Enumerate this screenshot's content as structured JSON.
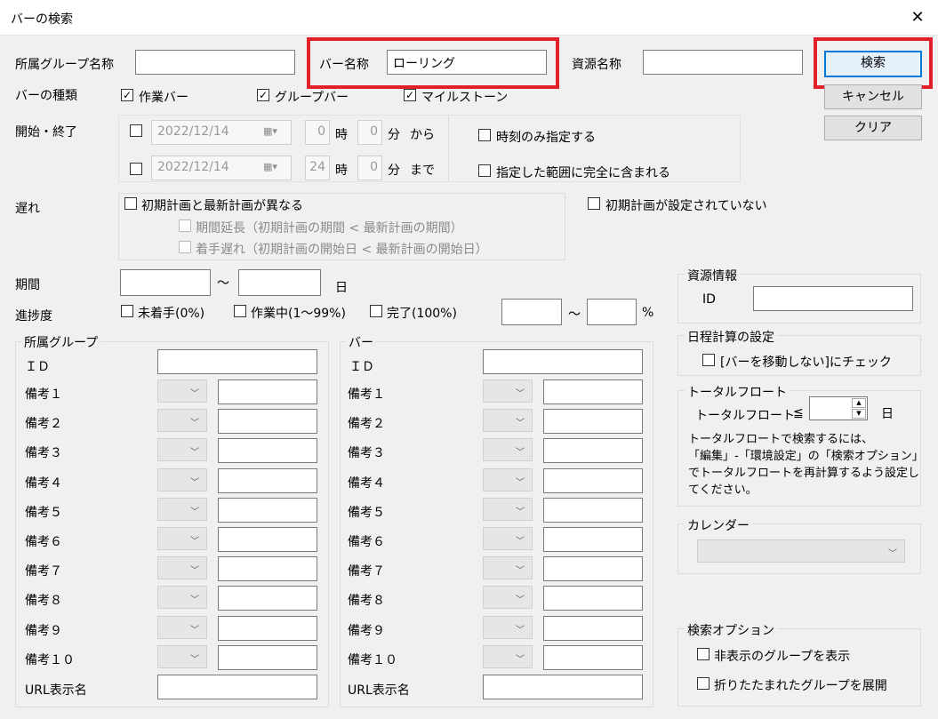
{
  "window": {
    "title": "バーの検索",
    "close": "✕"
  },
  "top": {
    "group_name_label": "所属グループ名称",
    "group_name_value": "",
    "bar_name_label": "バー名称",
    "bar_name_value": "ローリング",
    "resource_name_label": "資源名称",
    "resource_name_value": ""
  },
  "buttons": {
    "search": "検索",
    "cancel": "キャンセル",
    "clear": "クリア"
  },
  "bar_type": {
    "label": "バーの種類",
    "options": [
      {
        "label": "作業バー",
        "checked": true
      },
      {
        "label": "グループバー",
        "checked": true
      },
      {
        "label": "マイルストーン",
        "checked": true
      }
    ]
  },
  "start_end": {
    "label": "開始・終了",
    "rows": [
      {
        "date": "2022/12/14",
        "hour": "0",
        "hour_unit": "時",
        "minute": "0",
        "minute_unit": "分",
        "suffix": "から"
      },
      {
        "date": "2022/12/14",
        "hour": "24",
        "hour_unit": "時",
        "minute": "0",
        "minute_unit": "分",
        "suffix": "まで"
      }
    ],
    "time_only": "時刻のみ指定する",
    "fully_contained": "指定した範囲に完全に含まれる"
  },
  "delay": {
    "label": "遅れ",
    "differs": "初期計画と最新計画が異なる",
    "period_ext": "期間延長（初期計画の期間 < 最新計画の期間）",
    "start_delay": "着手遅れ（初期計画の開始日 < 最新計画の開始日）",
    "not_set": "初期計画が設定されていない"
  },
  "period": {
    "label": "期間",
    "tilde": "〜",
    "unit": "日"
  },
  "progress": {
    "label": "進捗度",
    "options": [
      "未着手(0%)",
      "作業中(1〜99%)",
      "完了(100%)"
    ],
    "tilde": "〜",
    "unit": "%"
  },
  "group_section": {
    "title": "所属グループ",
    "id_label": "ＩＤ",
    "notes": [
      "備考１",
      "備考２",
      "備考３",
      "備考４",
      "備考５",
      "備考６",
      "備考７",
      "備考８",
      "備考９",
      "備考１０"
    ],
    "url_label": "URL表示名"
  },
  "bar_section": {
    "title": "バー",
    "id_label": "ＩＤ",
    "notes": [
      "備考１",
      "備考２",
      "備考３",
      "備考４",
      "備考５",
      "備考６",
      "備考７",
      "備考８",
      "備考９",
      "備考１０"
    ],
    "url_label": "URL表示名"
  },
  "resource_info": {
    "title": "資源情報",
    "id_label": "ID"
  },
  "schedule": {
    "title": "日程計算の設定",
    "option": "[バーを移動しない]にチェック"
  },
  "total_float": {
    "title": "トータルフロート",
    "label": "トータルフロート",
    "op": "≦",
    "unit": "日",
    "note1": "トータルフロートで検索するには、",
    "note2": "「編集」-「環境設定」の「検索オプション」",
    "note3": "でトータルフロートを再計算するよう設定し",
    "note4": "てください。"
  },
  "calendar": {
    "title": "カレンダー"
  },
  "search_options": {
    "title": "検索オプション",
    "show_hidden": "非表示のグループを表示",
    "expand_folded": "折りたたまれたグループを展開"
  }
}
